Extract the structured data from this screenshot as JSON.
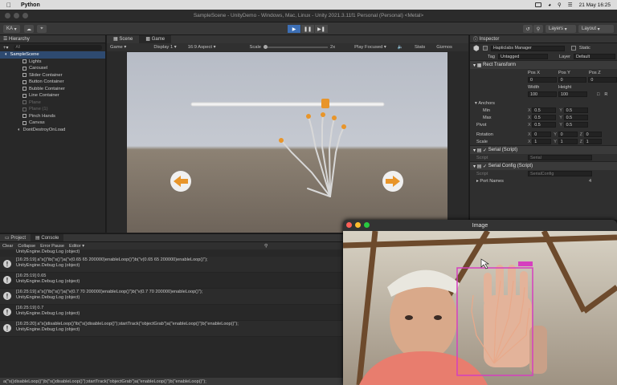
{
  "menubar": {
    "app_name": "Python",
    "datetime": "21 May  16:25"
  },
  "window": {
    "title": "SampleScene - UnityDemo - Windows, Mac, Linux - Unity 2021.3.11f1 Personal (Personal) <Metal>"
  },
  "toolbar": {
    "account": "KA",
    "layers": "Layers",
    "layout": "Layout"
  },
  "hierarchy": {
    "tab": "Hierarchy",
    "search_placeholder": "All",
    "items": [
      {
        "label": "SampleScene"
      },
      {
        "label": "Lights"
      },
      {
        "label": "Carousel"
      },
      {
        "label": "Slider Container"
      },
      {
        "label": "Button Container"
      },
      {
        "label": "Bubble Container"
      },
      {
        "label": "Line Container"
      },
      {
        "label": "Plane"
      },
      {
        "label": "Plane (1)"
      },
      {
        "label": "Pinch Hands"
      },
      {
        "label": "Canvas"
      },
      {
        "label": "DontDestroyOnLoad"
      }
    ]
  },
  "gameview": {
    "tabs": [
      "Scene",
      "Game"
    ],
    "mode": "Game",
    "display": "Display 1",
    "aspect": "16:9 Aspect",
    "scale_label": "Scale",
    "scale_value": "2x",
    "play_mode": "Play Focused",
    "stats": "Stats",
    "gizmos": "Gizmos"
  },
  "inspector": {
    "tab": "Inspector",
    "object_name": "Hapticlabs Manager",
    "static_label": "Static",
    "tag_label": "Tag",
    "tag_value": "Untagged",
    "layer_label": "Layer",
    "layer_value": "Default",
    "rect_transform": "Rect Transform",
    "pos_labels": [
      "Pos X",
      "Pos Y",
      "Pos Z"
    ],
    "pos_values": [
      "0",
      "0",
      "0"
    ],
    "width_label": "Width",
    "height_label": "Height",
    "width_value": "100",
    "height_value": "100",
    "anchors_label": "Anchors",
    "min_label": "Min",
    "min_x": "0.5",
    "min_y": "0.5",
    "max_label": "Max",
    "max_x": "0.5",
    "max_y": "0.5",
    "pivot_label": "Pivot",
    "pivot_x": "0.5",
    "pivot_y": "0.5",
    "rotation_label": "Rotation",
    "rotation_x": "0",
    "rotation_y": "0",
    "rotation_z": "0",
    "scale_label": "Scale",
    "scale_x": "1",
    "scale_y": "1",
    "scale_z": "1",
    "serial_script": "Serial (Script)",
    "script_label": "Script",
    "serial_script_value": "Serial",
    "serial_config": "Serial Config (Script)",
    "serial_config_value": "SerialConfig",
    "port_names_label": "Port Names",
    "port_names_count": "4"
  },
  "console": {
    "tabs": [
      "Project",
      "Console"
    ],
    "clear": "Clear",
    "collapse": "Collapse",
    "error_pause": "Error Pause",
    "editor": "Editor",
    "first_line": "UnityEngine.Debug:Log (object)",
    "entries": [
      {
        "line1": "[16:25:19] a\"s()\"ib(\"s()\")a(\"v(0.65 65 200000)enableLoop()\")b(\"v(0.65 65 200000)enableLoop()\");",
        "line2": "UnityEngine.Debug:Log (object)"
      },
      {
        "line1": "[16:25:19] 0.65",
        "line2": "UnityEngine.Debug:Log (object)"
      },
      {
        "line1": "[16:25:19] a\"s()\"ib(\"s()\")a(\"v(0.7 70 200000)enableLoop()\")b(\"v(0.7 70 200000)enableLoop()\");",
        "line2": "UnityEngine.Debug:Log (object)"
      },
      {
        "line1": "[16:25:19] 0.7",
        "line2": "UnityEngine.Debug:Log (object)"
      },
      {
        "line1": "[16:25:20] a\"s()disableLoop()\"ib(\"s()disableLoop()\");startTrack(\"objectGrab\")a(\"enableLoop()\")b(\"enableLoop()\");",
        "line2": "UnityEngine.Debug:Log (object)"
      }
    ],
    "status": "a(\"s()disableLoop()\")b(\"s()disableLoop()\");startTrack(\"objectGrab\")a(\"enableLoop()\")b(\"enableLoop()\");"
  },
  "image_window": {
    "title": "Image"
  },
  "colors": {
    "accent": "#3d6fb5",
    "hand_overlay": "#d63fbf",
    "skeleton": "#e8a98a",
    "arrow_button": "#e8952a"
  }
}
